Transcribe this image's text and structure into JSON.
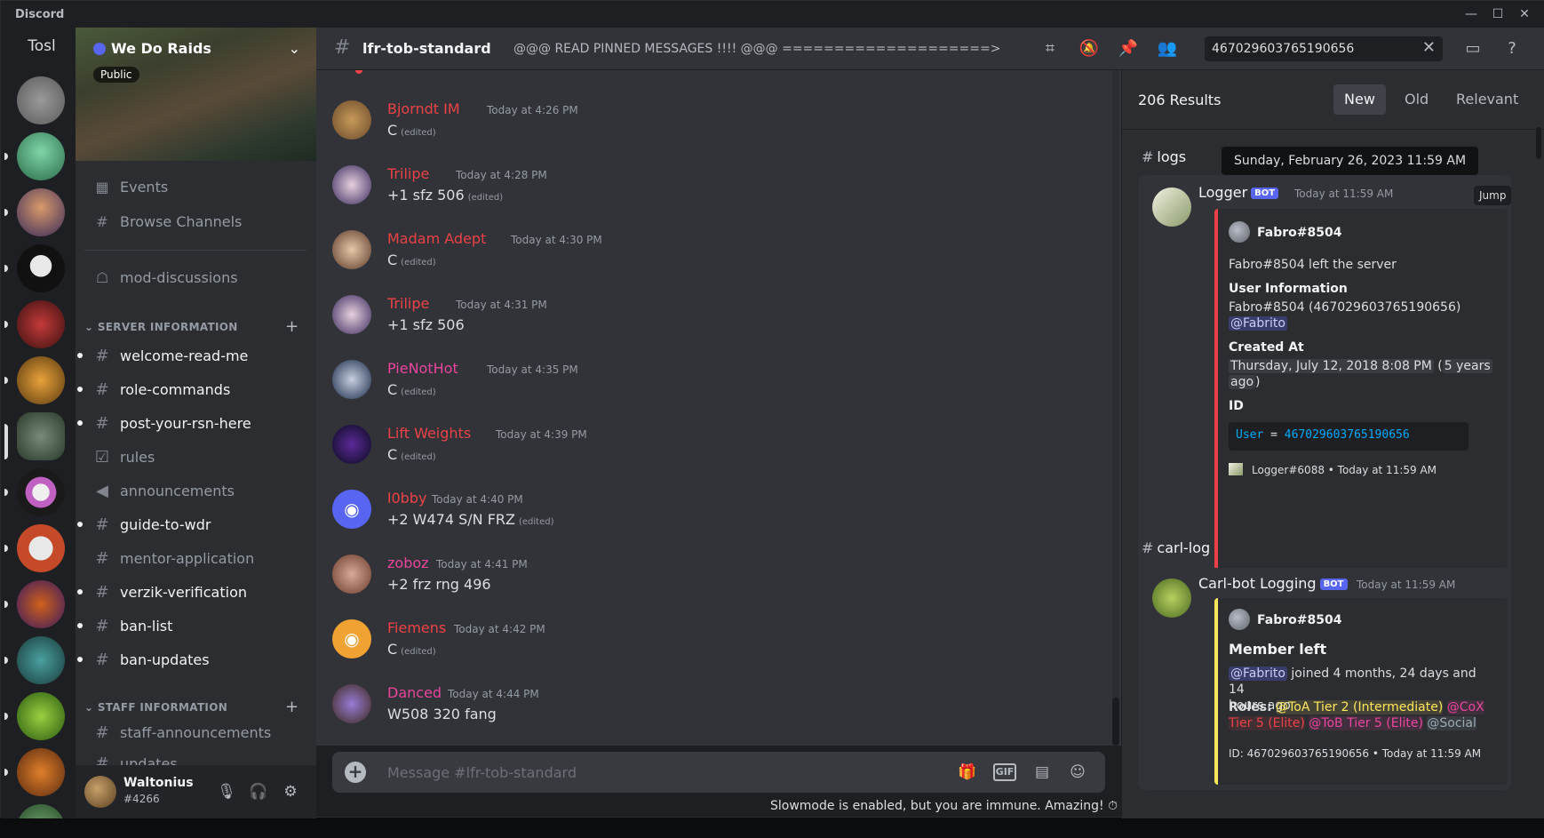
{
  "app": {
    "title": "Discord"
  },
  "window_controls": [
    "—",
    "☐",
    "✕"
  ],
  "colors": {
    "blurple": "#5865f2",
    "red_role": "#ed4245",
    "pink": "#eb459e",
    "yellow": "#fee75c",
    "online": "#23a55a"
  },
  "dm": {
    "label": "Tosl"
  },
  "server": {
    "name": "We Do Raids",
    "visibility": "Public"
  },
  "sidebar": {
    "nav": [
      {
        "label": "Events",
        "icon": "calendar-icon"
      },
      {
        "label": "Browse Channels",
        "icon": "browse-channels-icon"
      },
      {
        "label": "mod-discussions",
        "icon": "forum-icon"
      }
    ],
    "categories": [
      {
        "name": "SERVER INFORMATION",
        "channels": [
          {
            "label": "welcome-read-me",
            "unread": true
          },
          {
            "label": "role-commands",
            "unread": true
          },
          {
            "label": "post-your-rsn-here",
            "unread": true
          },
          {
            "label": "rules",
            "unread": false
          },
          {
            "label": "announcements",
            "unread": false
          },
          {
            "label": "guide-to-wdr",
            "unread": true
          },
          {
            "label": "mentor-application",
            "unread": false
          },
          {
            "label": "verzik-verification",
            "unread": true
          },
          {
            "label": "ban-list",
            "unread": true
          },
          {
            "label": "ban-updates",
            "unread": true
          }
        ]
      },
      {
        "name": "STAFF INFORMATION",
        "channels": [
          {
            "label": "staff-announcements",
            "unread": false
          },
          {
            "label": "updates",
            "unread": false
          }
        ]
      }
    ]
  },
  "user": {
    "name": "Waltonius",
    "tag": "#4266"
  },
  "header": {
    "channel": "lfr-tob-standard",
    "topic": "@@@ READ PINNED MESSAGES !!!! @@@ ====================>",
    "search_value": "467029603765190656"
  },
  "messages": [
    {
      "author": "Bjorndt IM",
      "color": "#ed4245",
      "time": "Today at 4:26 PM",
      "text": "C",
      "edited": "(edited)"
    },
    {
      "author": "Trilipe",
      "color": "#ed4245",
      "time": "Today at 4:28 PM",
      "text": "+1 sfz 506",
      "edited": "(edited)"
    },
    {
      "author": "Madam Adept",
      "color": "#ed4245",
      "time": "Today at 4:30 PM",
      "text": "C",
      "edited": "(edited)"
    },
    {
      "author": "Trilipe",
      "color": "#ed4245",
      "time": "Today at 4:31 PM",
      "text": "+1 sfz 506",
      "edited": ""
    },
    {
      "author": "PieNotHot",
      "color": "#eb459e",
      "time": "Today at 4:35 PM",
      "text": "C",
      "edited": "(edited)"
    },
    {
      "author": "Lift Weights",
      "color": "#ed4245",
      "time": "Today at 4:39 PM",
      "text": "C",
      "edited": "(edited)"
    },
    {
      "author": "l0bby",
      "color": "#ed4245",
      "time": "Today at 4:40 PM",
      "text": "+2 W474  S/N FRZ",
      "edited": "(edited)"
    },
    {
      "author": "zoboz",
      "color": "#eb459e",
      "time": "Today at 4:41 PM",
      "text": "+2 frz rng  496",
      "edited": ""
    },
    {
      "author": "Fiemens",
      "color": "#ed4245",
      "time": "Today at 4:42 PM",
      "text": "C",
      "edited": "(edited)"
    },
    {
      "author": "Danced",
      "color": "#eb459e",
      "time": "Today at 4:44 PM",
      "text": "W508 320 fang",
      "edited": ""
    }
  ],
  "composer": {
    "placeholder": "Message #lfr-tob-standard",
    "gif_label": "GIF"
  },
  "slowmode": "Slowmode is enabled, but you are immune. Amazing!",
  "results": {
    "count": "206 Results",
    "sorts": [
      "New",
      "Old",
      "Relevant"
    ],
    "tooltip": "Sunday, February 26, 2023 11:59 AM",
    "jump_label": "Jump",
    "groups": [
      {
        "channel": "logs",
        "bot": "Logger",
        "bot_tag": "BOT",
        "time": "Today at 11:59 AM",
        "embed": {
          "author": "Fabro#8504",
          "line1": "Fabro#8504 left the server",
          "user_info_label": "User Information",
          "user_info_value": "Fabro#8504 (467029603765190656)",
          "mention": "@Fabrito",
          "created_label": "Created At",
          "created_value": "Thursday, July 12, 2018 8:08 PM",
          "created_rel_a": "(",
          "created_rel_b": "5 years",
          "created_rel_c": "ago",
          "created_rel_d": ")",
          "id_label": "ID",
          "code_key": "User",
          "code_eq": "=",
          "code_val": "467029603765190656",
          "footer": "Logger#6088 • Today at 11:59 AM"
        }
      },
      {
        "channel": "carl-log",
        "bot": "Carl-bot Logging",
        "bot_tag": "BOT",
        "time": "Today at 11:59 AM",
        "embed": {
          "author": "Fabro#8504",
          "title": "Member left",
          "mention": "@Fabrito",
          "joined_a": "joined 4 months, 24 days and 14",
          "joined_b": "hours ago",
          "roles_label": "Roles:",
          "role1": "@ToA Tier 2 (Intermediate)",
          "role2": "@CoX",
          "role2b": "Tier 5 (Elite)",
          "role3": "@ToB Tier 5 (Elite)",
          "role4": "@Social",
          "footer": "ID: 467029603765190656 • Today at 11:59 AM"
        }
      }
    ]
  }
}
